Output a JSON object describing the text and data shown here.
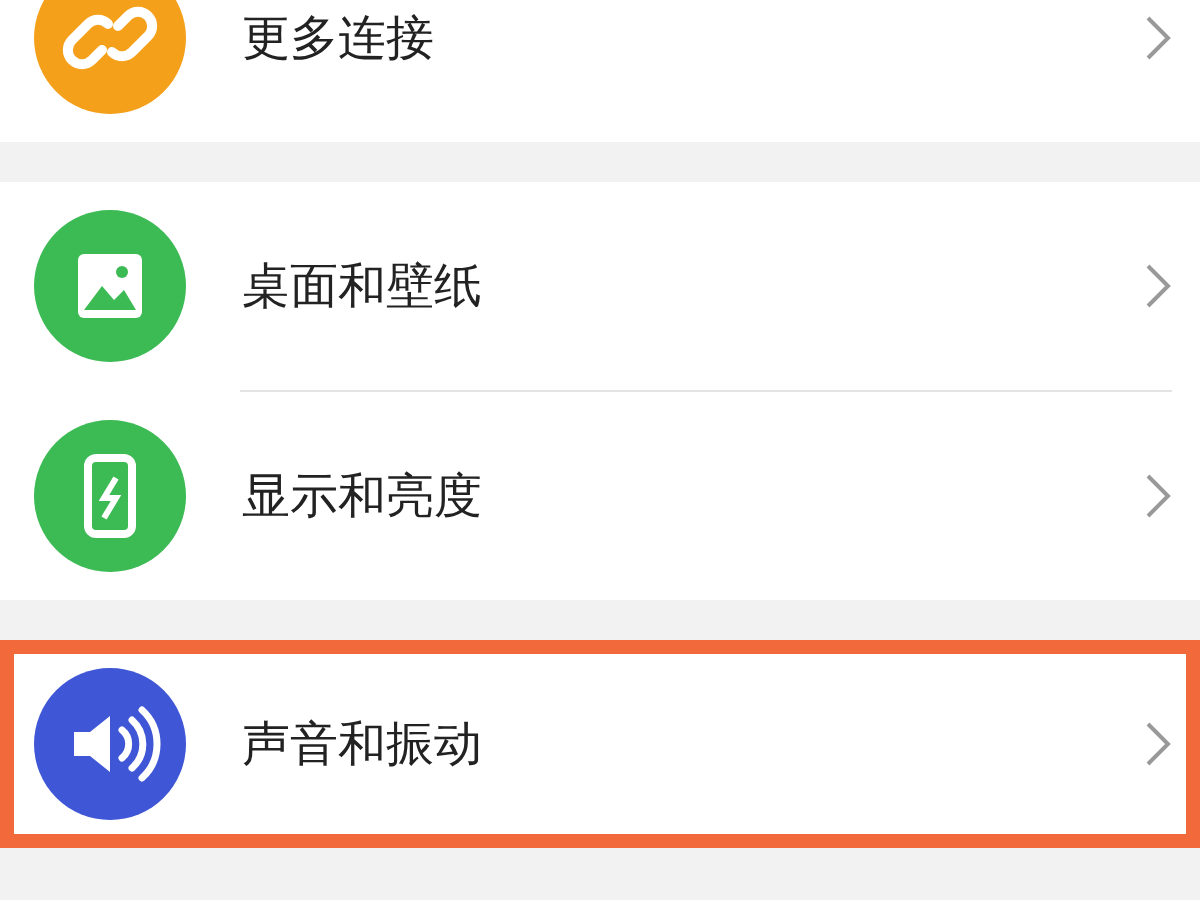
{
  "groups": [
    {
      "items": [
        {
          "label": "更多连接",
          "kind": "link",
          "color": "#f5a01a",
          "highlighted": false
        }
      ]
    },
    {
      "items": [
        {
          "label": "桌面和壁纸",
          "kind": "image",
          "color": "#3cba54",
          "highlighted": false
        },
        {
          "label": "显示和亮度",
          "kind": "phone",
          "color": "#3cba54",
          "highlighted": false
        }
      ]
    },
    {
      "items": [
        {
          "label": "声音和振动",
          "kind": "speaker",
          "color": "#3f57d6",
          "highlighted": true
        }
      ]
    }
  ]
}
